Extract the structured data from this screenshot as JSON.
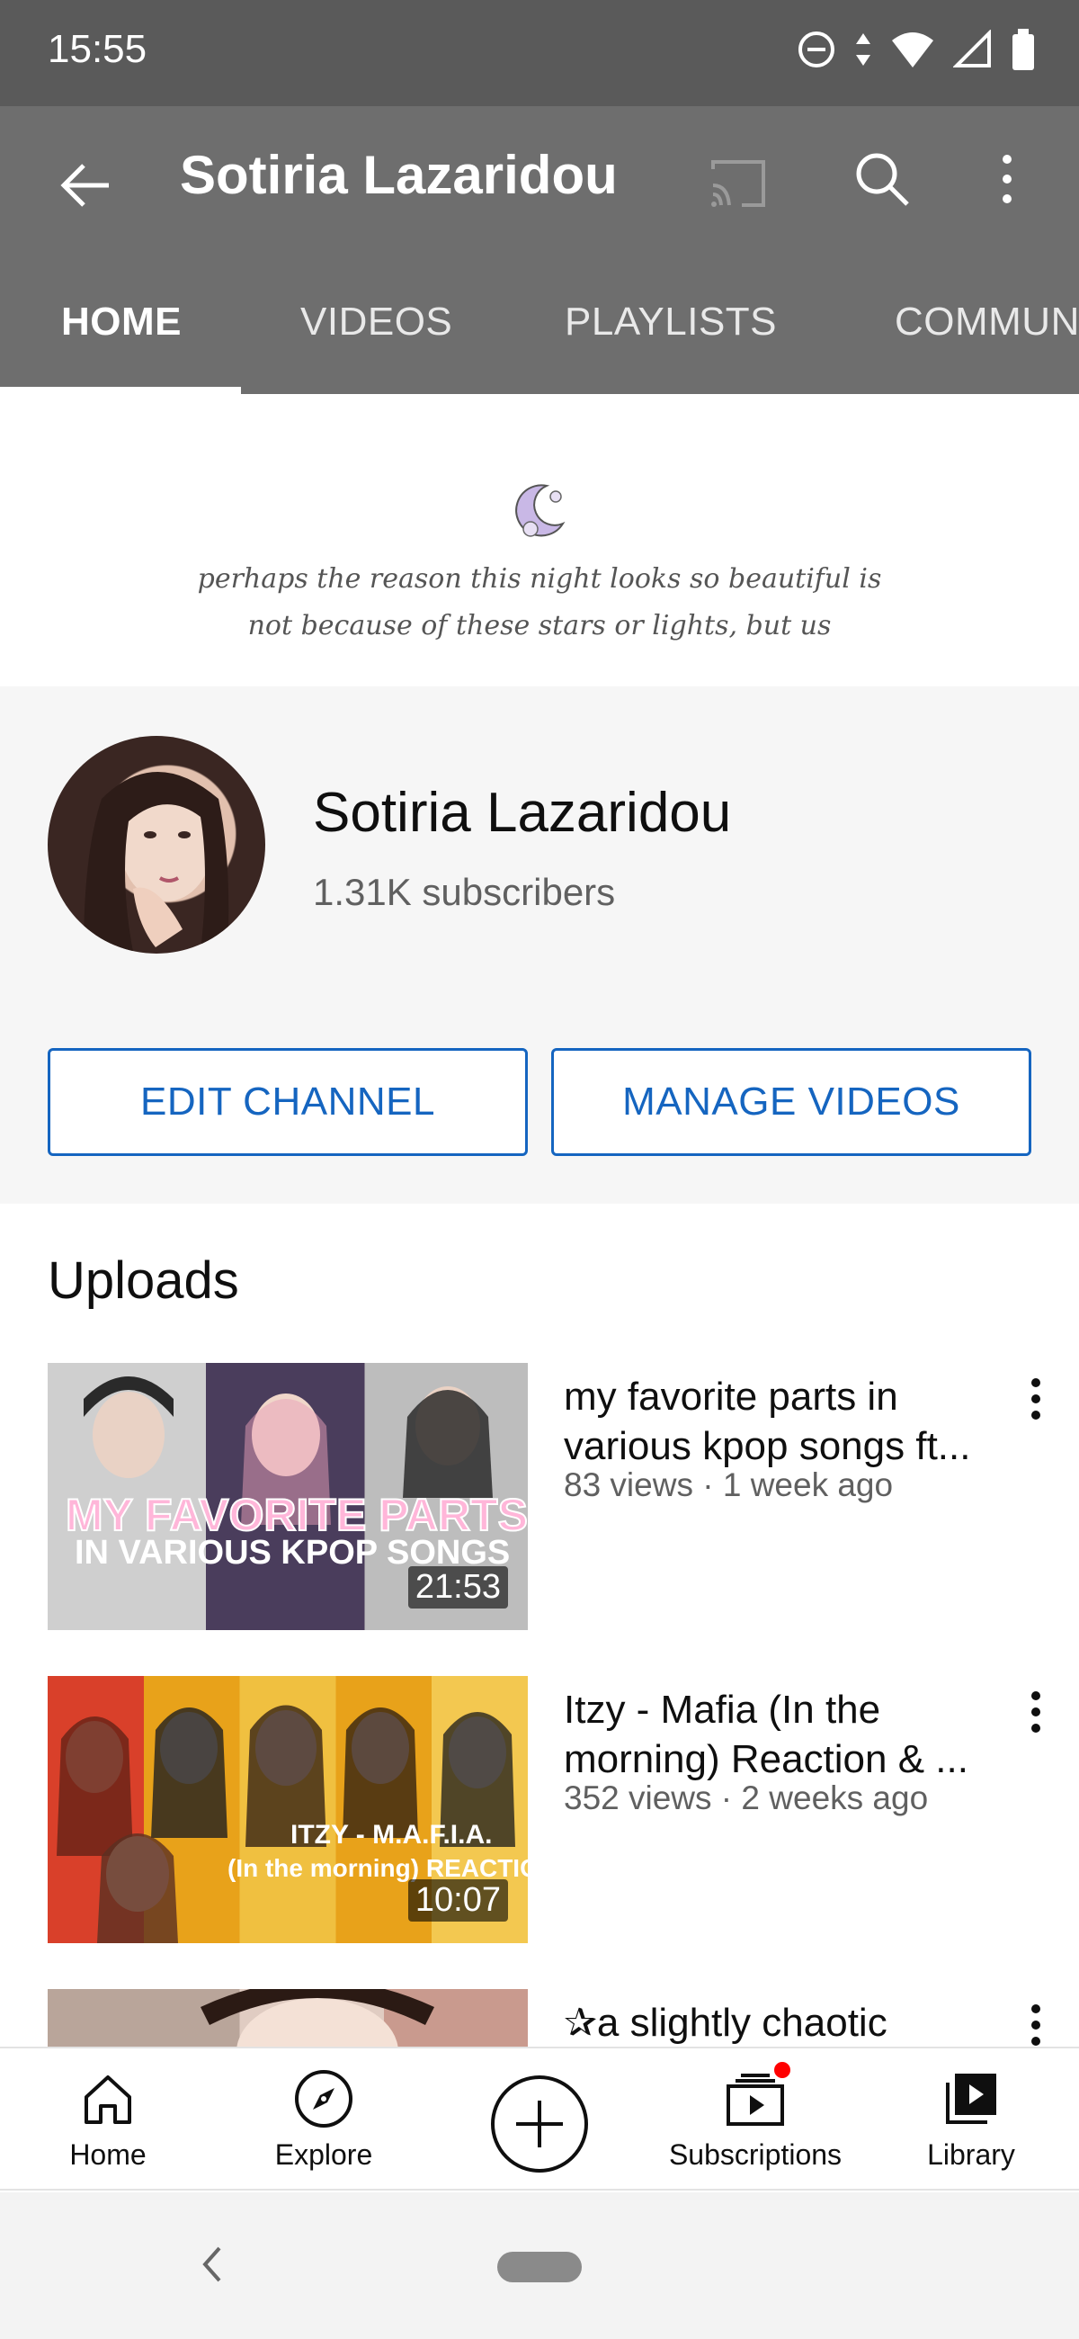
{
  "status_bar": {
    "time": "15:55",
    "icons": [
      "do-not-disturb-icon",
      "data-arrows-icon",
      "wifi-icon",
      "cell-signal-icon",
      "battery-icon"
    ]
  },
  "app_bar": {
    "title": "Sotiria Lazaridou",
    "icons": [
      "back-arrow-icon",
      "cast-icon",
      "search-icon",
      "more-vert-icon"
    ]
  },
  "tabs": [
    {
      "label": "HOME",
      "active": true
    },
    {
      "label": "VIDEOS",
      "active": false
    },
    {
      "label": "PLAYLISTS",
      "active": false
    },
    {
      "label": "COMMUN",
      "active": false
    }
  ],
  "banner": {
    "line1": "perhaps the reason this night looks so beautiful is",
    "line2": "not because of these stars or lights, but us"
  },
  "channel": {
    "name": "Sotiria Lazaridou",
    "subscribers": "1.31K subscribers",
    "edit_label": "EDIT CHANNEL",
    "manage_label": "MANAGE VIDEOS"
  },
  "uploads": {
    "title": "Uploads",
    "videos": [
      {
        "title": "my favorite parts in various kpop songs ft...",
        "meta": "83 views · 1 week ago",
        "duration": "21:53",
        "thumb_line1": "MY FAVORITE PARTS",
        "thumb_line2": "IN VARIOUS KPOP SONGS"
      },
      {
        "title": "Itzy - Mafia (In the morning) Reaction & ...",
        "meta": "352 views · 2 weeks ago",
        "duration": "10:07",
        "thumb_line1": "ITZY - M.A.F.I.A.",
        "thumb_line2": "(In the morning) REACTION"
      },
      {
        "title": "✰a slightly chaotic",
        "meta": "",
        "duration": ""
      }
    ]
  },
  "bottom_nav": {
    "home": "Home",
    "explore": "Explore",
    "subscriptions": "Subscriptions",
    "library": "Library"
  },
  "colors": {
    "accent": "#1565c0",
    "header": "#6e6e6e",
    "statusbar": "#5a5a5a",
    "notification": "#ff0000"
  }
}
